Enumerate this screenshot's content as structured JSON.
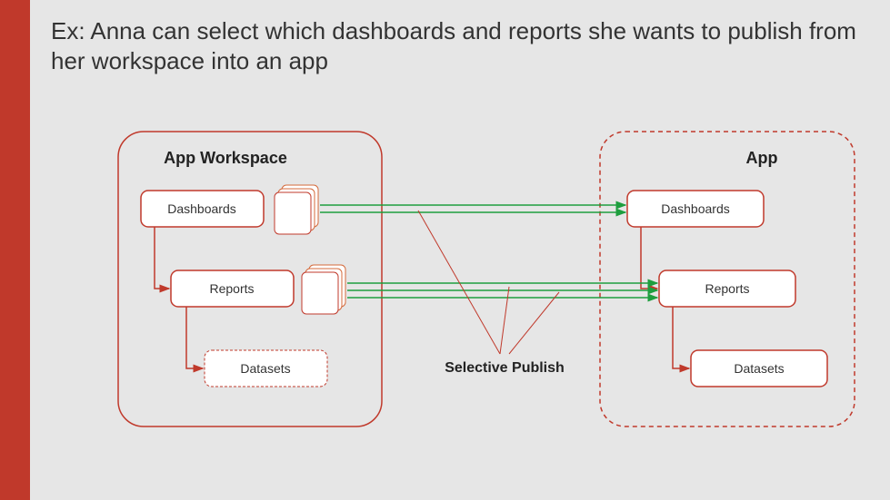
{
  "title": "Ex: Anna can select which dashboards and reports she wants to publish from her workspace into an app",
  "left": {
    "heading": "App Workspace",
    "box1": "Dashboards",
    "box2": "Reports",
    "box3": "Datasets"
  },
  "center": {
    "label": "Selective Publish"
  },
  "right": {
    "heading": "App",
    "box1": "Dashboards",
    "box2": "Reports",
    "box3": "Datasets"
  }
}
